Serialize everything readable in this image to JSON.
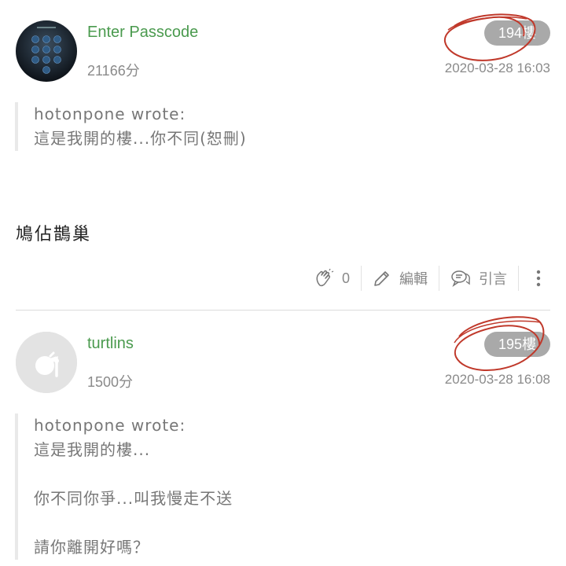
{
  "posts": [
    {
      "username": "Enter Passcode",
      "score": "21166分",
      "floor": "194樓",
      "date": "2020-03-28 16:03",
      "quote": {
        "author_line": "hotonpone wrote:",
        "lines": [
          "這是我開的樓...你不同(恕刪)"
        ]
      },
      "body": "鳩佔鵲巢",
      "actions": {
        "like_count": "0",
        "edit_label": "編輯",
        "quote_label": "引言"
      }
    },
    {
      "username": "turtlins",
      "score": "1500分",
      "floor": "195樓",
      "date": "2020-03-28 16:08",
      "quote": {
        "author_line": "hotonpone wrote:",
        "lines": [
          "這是我開的樓...",
          "",
          "你不同你爭...叫我慢走不送",
          "",
          "請你離開好嗎？"
        ]
      }
    }
  ],
  "colors": {
    "username": "#4a9a4e",
    "floor_badge": "#a9a9a9",
    "annotation_circle": "#c0392b"
  },
  "icons": [
    "passcode-avatar",
    "default-avatar-icon",
    "clap-icon",
    "pencil-icon",
    "quote-icon",
    "more-vertical-icon"
  ]
}
